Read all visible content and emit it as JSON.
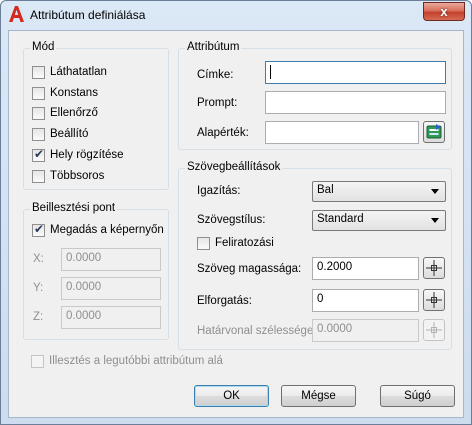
{
  "window": {
    "title": "Attribútum definiálása",
    "close_glyph": "x"
  },
  "mode": {
    "title": "Mód",
    "options": [
      {
        "label": "Láthatatlan",
        "checked": false
      },
      {
        "label": "Konstans",
        "checked": false
      },
      {
        "label": "Ellenőrző",
        "checked": false
      },
      {
        "label": "Beállító",
        "checked": false
      },
      {
        "label": "Hely rögzítése",
        "checked": true
      },
      {
        "label": "Többsoros",
        "checked": false
      }
    ]
  },
  "insertion": {
    "title": "Beillesztési pont",
    "specify_label": "Megadás a képernyőn",
    "specify_checked": true,
    "x_label": "X:",
    "x_value": "0.0000",
    "y_label": "Y:",
    "y_value": "0.0000",
    "z_label": "Z:",
    "z_value": "0.0000"
  },
  "attribute": {
    "title": "Attribútum",
    "tag_label": "Címke:",
    "tag_value": "",
    "prompt_label": "Prompt:",
    "prompt_value": "",
    "default_label": "Alapérték:",
    "default_value": ""
  },
  "text_settings": {
    "title": "Szövegbeállítások",
    "justify_label": "Igazítás:",
    "justify_value": "Bal",
    "style_label": "Szövegstílus:",
    "style_value": "Standard",
    "annotative_label": "Feliratozási",
    "annotative_checked": false,
    "height_label": "Szöveg magassága:",
    "height_value": "0.2000",
    "rotation_label": "Elforgatás:",
    "rotation_value": "0",
    "boundary_label": "Határvonal szélessége:",
    "boundary_value": "0.0000"
  },
  "align_below": {
    "label": "Illesztés a legutóbbi attribútum alá",
    "checked": false
  },
  "buttons": {
    "ok": "OK",
    "cancel": "Mégse",
    "help": "Súgó"
  },
  "icons": [
    "autocad-app-icon",
    "close-icon",
    "insert-field-icon",
    "pick-point-icon"
  ]
}
